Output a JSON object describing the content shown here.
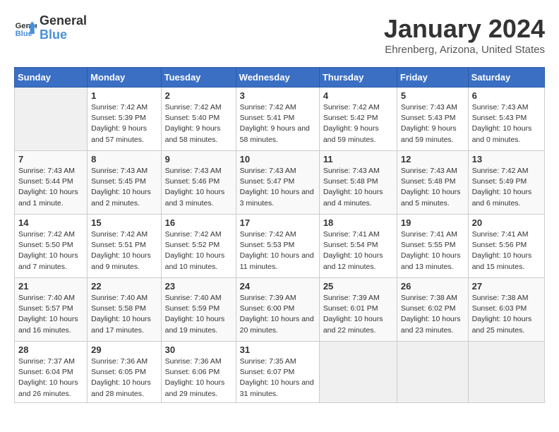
{
  "header": {
    "logo": {
      "line1": "General",
      "line2": "Blue"
    },
    "title": "January 2024",
    "location": "Ehrenberg, Arizona, United States"
  },
  "days_of_week": [
    "Sunday",
    "Monday",
    "Tuesday",
    "Wednesday",
    "Thursday",
    "Friday",
    "Saturday"
  ],
  "weeks": [
    [
      {
        "num": "",
        "sunrise": "",
        "sunset": "",
        "daylight": ""
      },
      {
        "num": "1",
        "sunrise": "Sunrise: 7:42 AM",
        "sunset": "Sunset: 5:39 PM",
        "daylight": "Daylight: 9 hours and 57 minutes."
      },
      {
        "num": "2",
        "sunrise": "Sunrise: 7:42 AM",
        "sunset": "Sunset: 5:40 PM",
        "daylight": "Daylight: 9 hours and 58 minutes."
      },
      {
        "num": "3",
        "sunrise": "Sunrise: 7:42 AM",
        "sunset": "Sunset: 5:41 PM",
        "daylight": "Daylight: 9 hours and 58 minutes."
      },
      {
        "num": "4",
        "sunrise": "Sunrise: 7:42 AM",
        "sunset": "Sunset: 5:42 PM",
        "daylight": "Daylight: 9 hours and 59 minutes."
      },
      {
        "num": "5",
        "sunrise": "Sunrise: 7:43 AM",
        "sunset": "Sunset: 5:43 PM",
        "daylight": "Daylight: 9 hours and 59 minutes."
      },
      {
        "num": "6",
        "sunrise": "Sunrise: 7:43 AM",
        "sunset": "Sunset: 5:43 PM",
        "daylight": "Daylight: 10 hours and 0 minutes."
      }
    ],
    [
      {
        "num": "7",
        "sunrise": "Sunrise: 7:43 AM",
        "sunset": "Sunset: 5:44 PM",
        "daylight": "Daylight: 10 hours and 1 minute."
      },
      {
        "num": "8",
        "sunrise": "Sunrise: 7:43 AM",
        "sunset": "Sunset: 5:45 PM",
        "daylight": "Daylight: 10 hours and 2 minutes."
      },
      {
        "num": "9",
        "sunrise": "Sunrise: 7:43 AM",
        "sunset": "Sunset: 5:46 PM",
        "daylight": "Daylight: 10 hours and 3 minutes."
      },
      {
        "num": "10",
        "sunrise": "Sunrise: 7:43 AM",
        "sunset": "Sunset: 5:47 PM",
        "daylight": "Daylight: 10 hours and 3 minutes."
      },
      {
        "num": "11",
        "sunrise": "Sunrise: 7:43 AM",
        "sunset": "Sunset: 5:48 PM",
        "daylight": "Daylight: 10 hours and 4 minutes."
      },
      {
        "num": "12",
        "sunrise": "Sunrise: 7:43 AM",
        "sunset": "Sunset: 5:48 PM",
        "daylight": "Daylight: 10 hours and 5 minutes."
      },
      {
        "num": "13",
        "sunrise": "Sunrise: 7:42 AM",
        "sunset": "Sunset: 5:49 PM",
        "daylight": "Daylight: 10 hours and 6 minutes."
      }
    ],
    [
      {
        "num": "14",
        "sunrise": "Sunrise: 7:42 AM",
        "sunset": "Sunset: 5:50 PM",
        "daylight": "Daylight: 10 hours and 7 minutes."
      },
      {
        "num": "15",
        "sunrise": "Sunrise: 7:42 AM",
        "sunset": "Sunset: 5:51 PM",
        "daylight": "Daylight: 10 hours and 9 minutes."
      },
      {
        "num": "16",
        "sunrise": "Sunrise: 7:42 AM",
        "sunset": "Sunset: 5:52 PM",
        "daylight": "Daylight: 10 hours and 10 minutes."
      },
      {
        "num": "17",
        "sunrise": "Sunrise: 7:42 AM",
        "sunset": "Sunset: 5:53 PM",
        "daylight": "Daylight: 10 hours and 11 minutes."
      },
      {
        "num": "18",
        "sunrise": "Sunrise: 7:41 AM",
        "sunset": "Sunset: 5:54 PM",
        "daylight": "Daylight: 10 hours and 12 minutes."
      },
      {
        "num": "19",
        "sunrise": "Sunrise: 7:41 AM",
        "sunset": "Sunset: 5:55 PM",
        "daylight": "Daylight: 10 hours and 13 minutes."
      },
      {
        "num": "20",
        "sunrise": "Sunrise: 7:41 AM",
        "sunset": "Sunset: 5:56 PM",
        "daylight": "Daylight: 10 hours and 15 minutes."
      }
    ],
    [
      {
        "num": "21",
        "sunrise": "Sunrise: 7:40 AM",
        "sunset": "Sunset: 5:57 PM",
        "daylight": "Daylight: 10 hours and 16 minutes."
      },
      {
        "num": "22",
        "sunrise": "Sunrise: 7:40 AM",
        "sunset": "Sunset: 5:58 PM",
        "daylight": "Daylight: 10 hours and 17 minutes."
      },
      {
        "num": "23",
        "sunrise": "Sunrise: 7:40 AM",
        "sunset": "Sunset: 5:59 PM",
        "daylight": "Daylight: 10 hours and 19 minutes."
      },
      {
        "num": "24",
        "sunrise": "Sunrise: 7:39 AM",
        "sunset": "Sunset: 6:00 PM",
        "daylight": "Daylight: 10 hours and 20 minutes."
      },
      {
        "num": "25",
        "sunrise": "Sunrise: 7:39 AM",
        "sunset": "Sunset: 6:01 PM",
        "daylight": "Daylight: 10 hours and 22 minutes."
      },
      {
        "num": "26",
        "sunrise": "Sunrise: 7:38 AM",
        "sunset": "Sunset: 6:02 PM",
        "daylight": "Daylight: 10 hours and 23 minutes."
      },
      {
        "num": "27",
        "sunrise": "Sunrise: 7:38 AM",
        "sunset": "Sunset: 6:03 PM",
        "daylight": "Daylight: 10 hours and 25 minutes."
      }
    ],
    [
      {
        "num": "28",
        "sunrise": "Sunrise: 7:37 AM",
        "sunset": "Sunset: 6:04 PM",
        "daylight": "Daylight: 10 hours and 26 minutes."
      },
      {
        "num": "29",
        "sunrise": "Sunrise: 7:36 AM",
        "sunset": "Sunset: 6:05 PM",
        "daylight": "Daylight: 10 hours and 28 minutes."
      },
      {
        "num": "30",
        "sunrise": "Sunrise: 7:36 AM",
        "sunset": "Sunset: 6:06 PM",
        "daylight": "Daylight: 10 hours and 29 minutes."
      },
      {
        "num": "31",
        "sunrise": "Sunrise: 7:35 AM",
        "sunset": "Sunset: 6:07 PM",
        "daylight": "Daylight: 10 hours and 31 minutes."
      },
      {
        "num": "",
        "sunrise": "",
        "sunset": "",
        "daylight": ""
      },
      {
        "num": "",
        "sunrise": "",
        "sunset": "",
        "daylight": ""
      },
      {
        "num": "",
        "sunrise": "",
        "sunset": "",
        "daylight": ""
      }
    ]
  ]
}
